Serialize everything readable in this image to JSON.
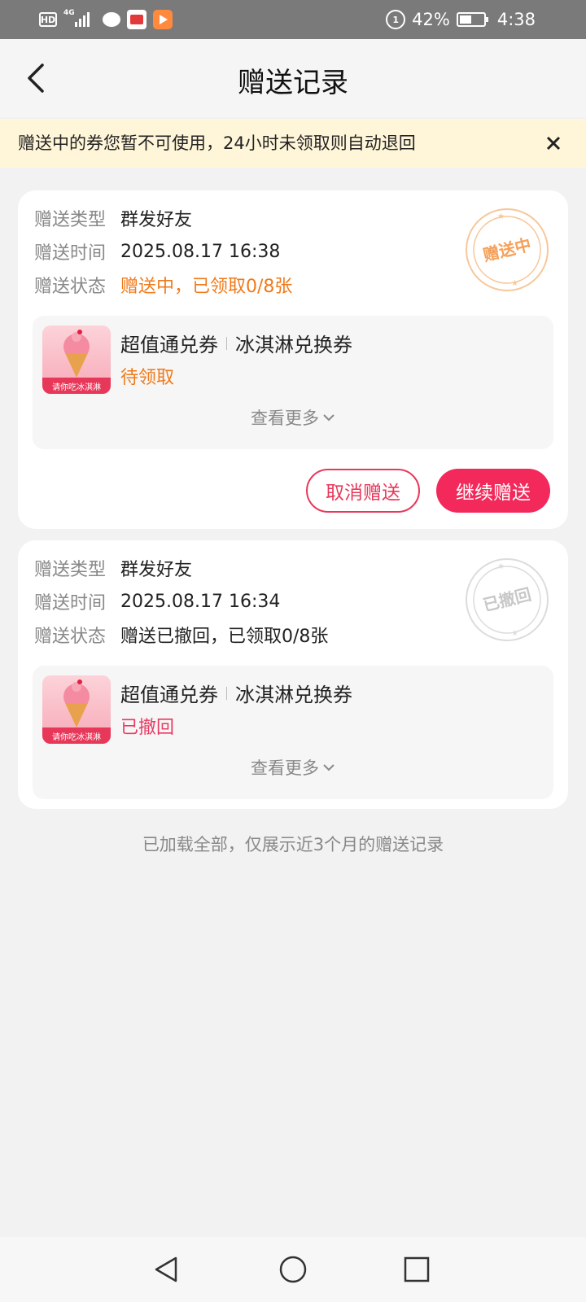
{
  "status_bar": {
    "left_icons": [
      "hd-icon",
      "network-4g-signal-icon",
      "chat-bubble-icon",
      "app-icon",
      "video-app-icon"
    ],
    "network_label": "4G",
    "hd_label": "HD",
    "battery_percent": "42%",
    "time": "4:38"
  },
  "header": {
    "title": "赠送记录",
    "back_icon": "chevron-left-icon"
  },
  "notice": {
    "text": "赠送中的券您暂不可使用，24小时未领取则自动退回",
    "close_icon": "close-icon"
  },
  "records": [
    {
      "type_label": "赠送类型",
      "type_value": "群发好友",
      "time_label": "赠送时间",
      "time_value": "2025.08.17 16:38",
      "status_label": "赠送状态",
      "status_value": "赠送中，已领取0/8张",
      "stamp_text": "赠送中",
      "stamp_color": "#f5a05a",
      "coupon": {
        "name": "超值通兑券",
        "sub": "冰淇淋兑换券",
        "status": "待领取",
        "thumb_band": "请你吃冰淇淋"
      },
      "more_label": "查看更多",
      "actions": {
        "cancel": "取消赠送",
        "continue": "继续赠送"
      }
    },
    {
      "type_label": "赠送类型",
      "type_value": "群发好友",
      "time_label": "赠送时间",
      "time_value": "2025.08.17 16:34",
      "status_label": "赠送状态",
      "status_value": "赠送已撤回，已领取0/8张",
      "stamp_text": "已撤回",
      "stamp_color": "#c8c8c8",
      "coupon": {
        "name": "超值通兑券",
        "sub": "冰淇淋兑换券",
        "status": "已撤回",
        "thumb_band": "请你吃冰淇淋"
      },
      "more_label": "查看更多"
    }
  ],
  "footer_note": "已加载全部，仅展示近3个月的赠送记录",
  "colors": {
    "accent": "#f2295a",
    "orange": "#f07a1a",
    "notice_bg": "#fff6d9"
  },
  "nav_bar": {
    "icons": [
      "nav-back-icon",
      "nav-home-icon",
      "nav-recents-icon"
    ]
  }
}
